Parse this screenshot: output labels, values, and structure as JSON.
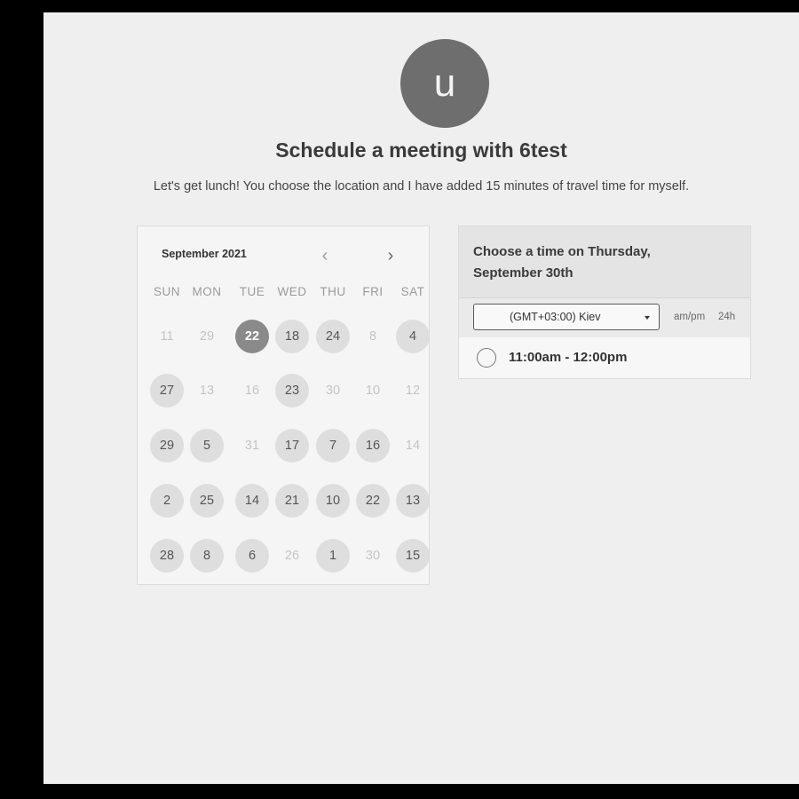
{
  "profile": {
    "initial": "u"
  },
  "page": {
    "title": "Schedule a meeting with 6test",
    "subtitle": "Let's get lunch! You choose the location and I have added 15 minutes of travel time for myself."
  },
  "calendar": {
    "month_label": "September 2021",
    "prev_icon": "‹",
    "next_icon": "›",
    "weekdays": [
      "SUN",
      "MON",
      "TUE",
      "WED",
      "THU",
      "FRI",
      "SAT"
    ],
    "weeks": [
      [
        {
          "day": "11",
          "state": "unavailable"
        },
        {
          "day": "29",
          "state": "unavailable"
        },
        {
          "day": "22",
          "state": "selected"
        },
        {
          "day": "18",
          "state": "available"
        },
        {
          "day": "24",
          "state": "available"
        },
        {
          "day": "8",
          "state": "unavailable"
        },
        {
          "day": "4",
          "state": "available"
        }
      ],
      [
        {
          "day": "27",
          "state": "available"
        },
        {
          "day": "13",
          "state": "unavailable"
        },
        {
          "day": "16",
          "state": "unavailable"
        },
        {
          "day": "23",
          "state": "available"
        },
        {
          "day": "30",
          "state": "unavailable"
        },
        {
          "day": "10",
          "state": "unavailable"
        },
        {
          "day": "12",
          "state": "unavailable"
        }
      ],
      [
        {
          "day": "29",
          "state": "available"
        },
        {
          "day": "5",
          "state": "available"
        },
        {
          "day": "31",
          "state": "unavailable"
        },
        {
          "day": "17",
          "state": "available"
        },
        {
          "day": "7",
          "state": "available"
        },
        {
          "day": "16",
          "state": "available"
        },
        {
          "day": "14",
          "state": "unavailable"
        }
      ],
      [
        {
          "day": "2",
          "state": "available"
        },
        {
          "day": "25",
          "state": "available"
        },
        {
          "day": "14",
          "state": "available"
        },
        {
          "day": "21",
          "state": "available"
        },
        {
          "day": "10",
          "state": "available"
        },
        {
          "day": "22",
          "state": "available"
        },
        {
          "day": "13",
          "state": "available"
        }
      ],
      [
        {
          "day": "28",
          "state": "available"
        },
        {
          "day": "8",
          "state": "available"
        },
        {
          "day": "6",
          "state": "available"
        },
        {
          "day": "26",
          "state": "unavailable"
        },
        {
          "day": "1",
          "state": "available"
        },
        {
          "day": "30",
          "state": "unavailable"
        },
        {
          "day": "15",
          "state": "available"
        }
      ]
    ]
  },
  "time_panel": {
    "heading": "Choose a time on Thursday, September 30th",
    "timezone": "(GMT+03:00) Kiev",
    "format_ampm": "am/pm",
    "format_24h": "24h",
    "slots": [
      "11:00am - 12:00pm"
    ]
  },
  "colors": {
    "background": "#efefef",
    "avatar": "#6e6e6e",
    "selected_day": "#8a8a8a",
    "available_day": "#dedede"
  }
}
